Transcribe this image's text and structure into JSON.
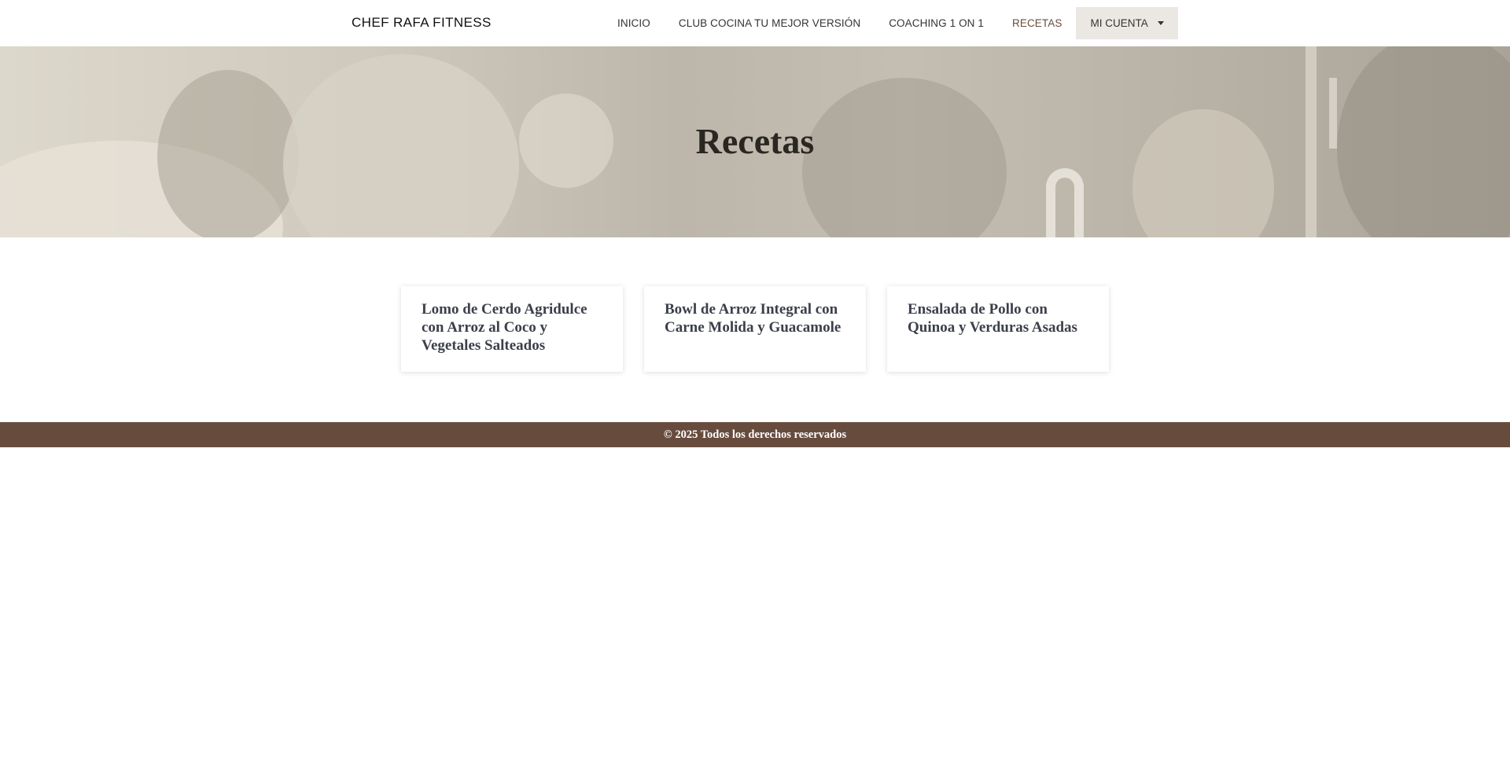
{
  "header": {
    "brand": "CHEF RAFA FITNESS",
    "nav": [
      {
        "label": "INICIO"
      },
      {
        "label": "CLUB COCINA TU MEJOR VERSIÓN"
      },
      {
        "label": "COACHING 1 ON 1"
      },
      {
        "label": "RECETAS",
        "active": true
      }
    ],
    "account_label": "MI CUENTA"
  },
  "hero": {
    "title": "Recetas"
  },
  "recipes": [
    {
      "title": "Lomo de Cerdo Agridulce con Arroz al Coco y Vegetales Salteados"
    },
    {
      "title": "Bowl de Arroz Integral con Carne Molida y Guacamole"
    },
    {
      "title": "Ensalada de Pollo con Quinoa y Verduras Asadas"
    }
  ],
  "footer": {
    "copyright": "© 2025 Todos los derechos reservados"
  },
  "colors": {
    "accent": "#6b4c3b",
    "footer_bg": "#674c3e",
    "account_bg": "#ebe8e4"
  }
}
